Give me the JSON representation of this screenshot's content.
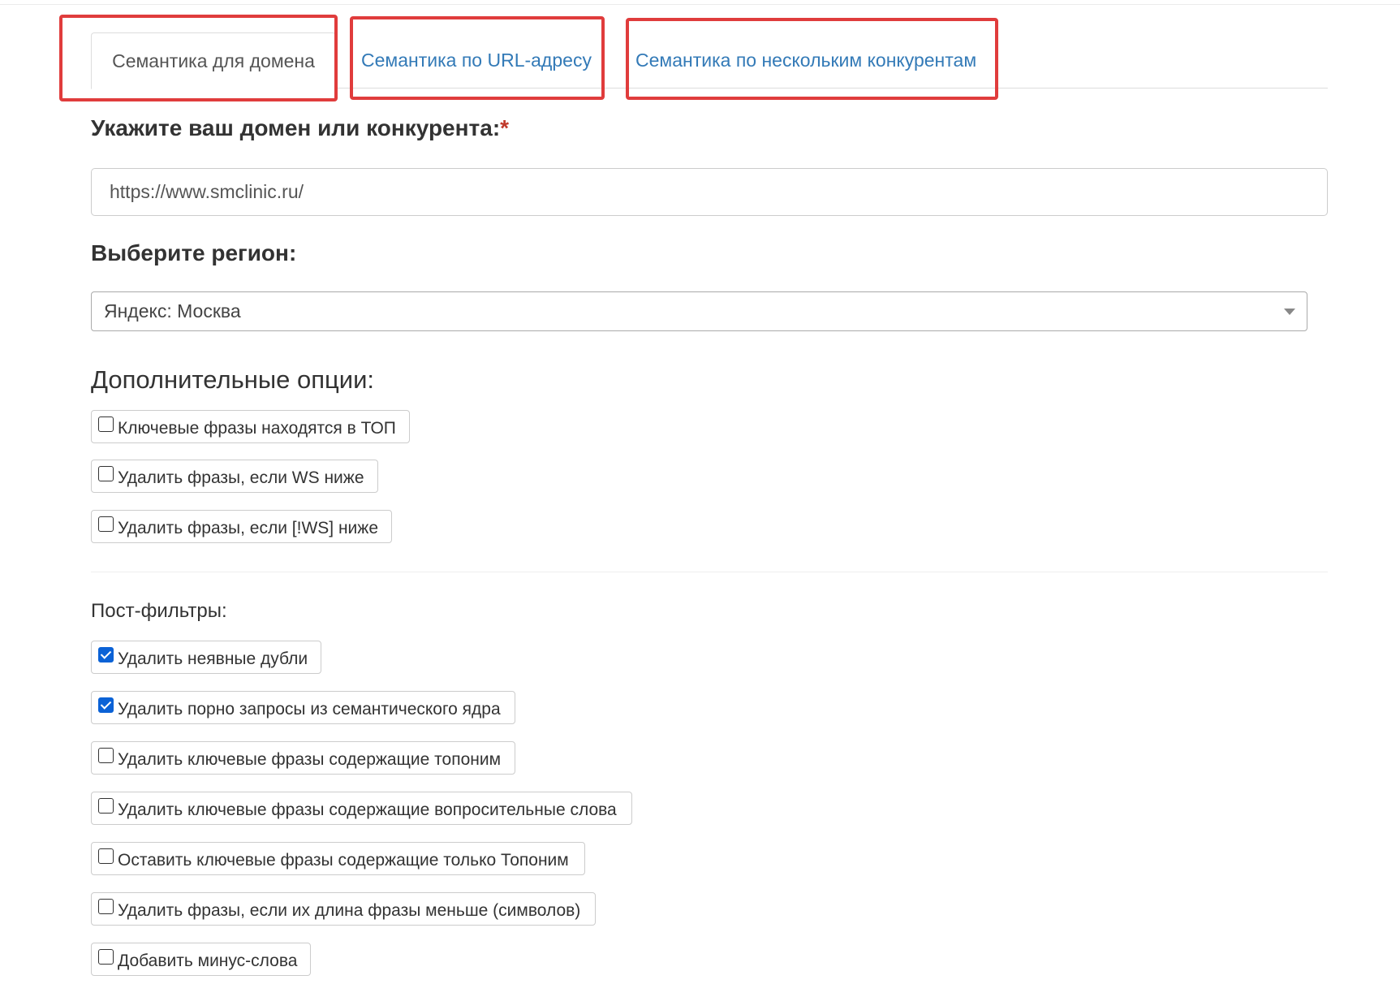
{
  "tabs": [
    {
      "label": "Семантика для домена",
      "active": true
    },
    {
      "label": "Семантика по URL-адресу",
      "active": false
    },
    {
      "label": "Семантика по нескольким конкурентам",
      "active": false
    }
  ],
  "form": {
    "domain_label": "Укажите ваш домен или конкурента:",
    "required_mark": "*",
    "domain_value": "https://www.smclinic.ru/",
    "region_label": "Выберите регион:",
    "region_value": "Яндекс: Москва",
    "extra_title": "Дополнительные опции:",
    "extra_options": [
      {
        "label": "Ключевые фразы находятся в ТОП",
        "checked": false
      },
      {
        "label": "Удалить фразы, если WS ниже",
        "checked": false
      },
      {
        "label": "Удалить фразы, если [!WS] ниже",
        "checked": false
      }
    ],
    "postfilter_title": "Пост-фильтры:",
    "postfilters": [
      {
        "label": "Удалить неявные дубли",
        "checked": true
      },
      {
        "label": "Удалить порно запросы из семантического ядра",
        "checked": true
      },
      {
        "label": "Удалить ключевые фразы содержащие топоним",
        "checked": false
      },
      {
        "label": "Удалить ключевые фразы содержащие вопросительные слова",
        "checked": false
      },
      {
        "label": "Оставить ключевые фразы содержащие только Топоним",
        "checked": false
      },
      {
        "label": "Удалить фразы, если их длина фразы меньше (символов)",
        "checked": false
      },
      {
        "label": "Добавить минус-слова",
        "checked": false
      }
    ]
  },
  "colors": {
    "highlight": "#e03c3c",
    "link": "#337ab7",
    "checkbox_checked": "#0b62d6"
  }
}
